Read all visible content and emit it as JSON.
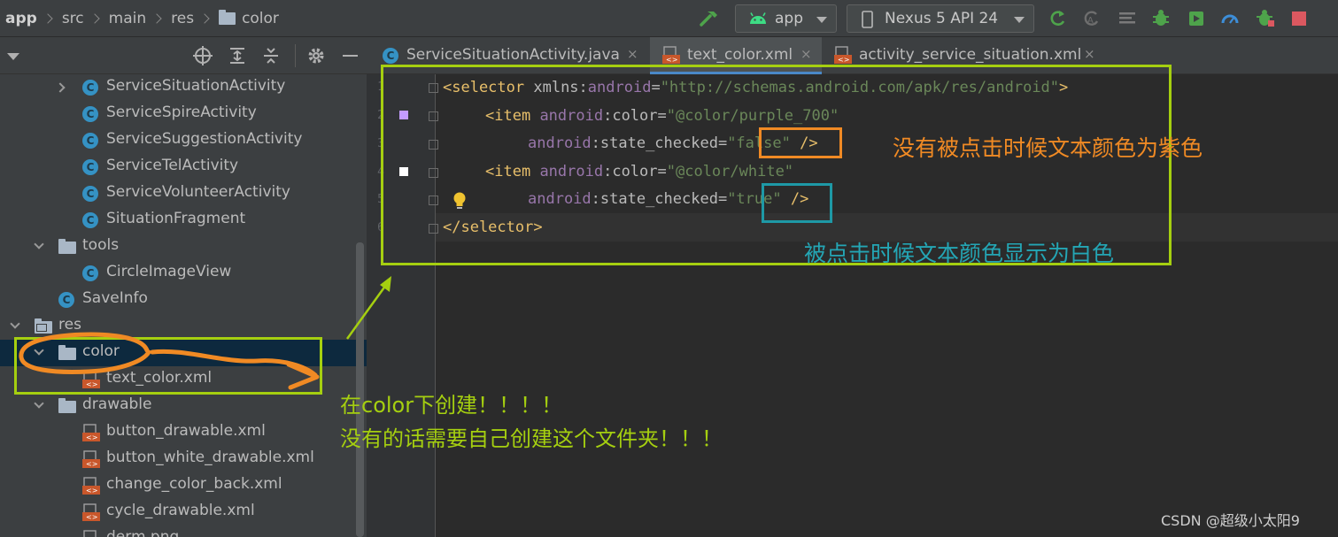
{
  "breadcrumb": [
    "app",
    "src",
    "main",
    "res",
    "color"
  ],
  "toolbar": {
    "run_config": "app",
    "device": "Nexus 5 API 24"
  },
  "project_tree": [
    {
      "label": "ServiceSituationActivity",
      "kind": "class",
      "arrow": "right"
    },
    {
      "label": "ServiceSpireActivity",
      "kind": "class"
    },
    {
      "label": "ServiceSuggestionActivity",
      "kind": "class"
    },
    {
      "label": "ServiceTelActivity",
      "kind": "class"
    },
    {
      "label": "ServiceVolunteerActivity",
      "kind": "class"
    },
    {
      "label": "SituationFragment",
      "kind": "class"
    },
    {
      "label": "tools",
      "kind": "package",
      "arrow": "down"
    },
    {
      "label": "CircleImageView",
      "kind": "class"
    },
    {
      "label": "SaveInfo",
      "kind": "class"
    },
    {
      "label": "res",
      "kind": "res-folder",
      "arrow": "down"
    },
    {
      "label": "color",
      "kind": "folder",
      "arrow": "down",
      "selected": true
    },
    {
      "label": "text_color.xml",
      "kind": "xml"
    },
    {
      "label": "drawable",
      "kind": "folder",
      "arrow": "down"
    },
    {
      "label": "button_drawable.xml",
      "kind": "xml"
    },
    {
      "label": "button_white_drawable.xml",
      "kind": "xml"
    },
    {
      "label": "change_color_back.xml",
      "kind": "xml"
    },
    {
      "label": "cycle_drawable.xml",
      "kind": "xml"
    },
    {
      "label": "derm.png",
      "kind": "xml"
    }
  ],
  "tabs": [
    {
      "label": "ServiceSituationActivity.java",
      "close": "×"
    },
    {
      "label": "text_color.xml",
      "close": "×",
      "active": true
    },
    {
      "label": "activity_service_situation.xml",
      "close": "×"
    }
  ],
  "line_numbers": [
    "1",
    "2",
    "3",
    "4",
    "5",
    "6"
  ],
  "code": {
    "l1": {
      "open": "<selector",
      "attr": " xmlns:",
      "ns": "android",
      "eq": "=",
      "val": "\"http://schemas.android.com/apk/res/android\"",
      "close": ">"
    },
    "l2": {
      "open": "<item",
      "ns": "android",
      "attr": ":color=",
      "val": "\"@color/purple_700\""
    },
    "l3": {
      "ns": "android",
      "attr": ":state_checked=",
      "val": "\"false\"",
      "close": " />"
    },
    "l4": {
      "open": "<item",
      "ns": "android",
      "attr": ":color=",
      "val": "\"@color/white\""
    },
    "l5": {
      "ns": "android",
      "attr": ":state_checked=",
      "val": "\"true\"",
      "close": " />"
    },
    "l6": {
      "tag": "</selector>"
    }
  },
  "swatch_colors": {
    "purple_700": "#c39bff",
    "white": "#ffffff"
  },
  "annotations": {
    "false_note": "没有被点击时候文本颜色为紫色",
    "true_note": "被点击时候文本颜色显示为白色",
    "folder_note_1": "在color下创建！！！！",
    "folder_note_2": "没有的话需要自己创建这个文件夹！！！"
  },
  "annotation_colors": {
    "orange": "#f08a24",
    "teal": "#24a6b5",
    "green": "#a5cf10"
  },
  "watermark": "CSDN @超级小太阳9"
}
